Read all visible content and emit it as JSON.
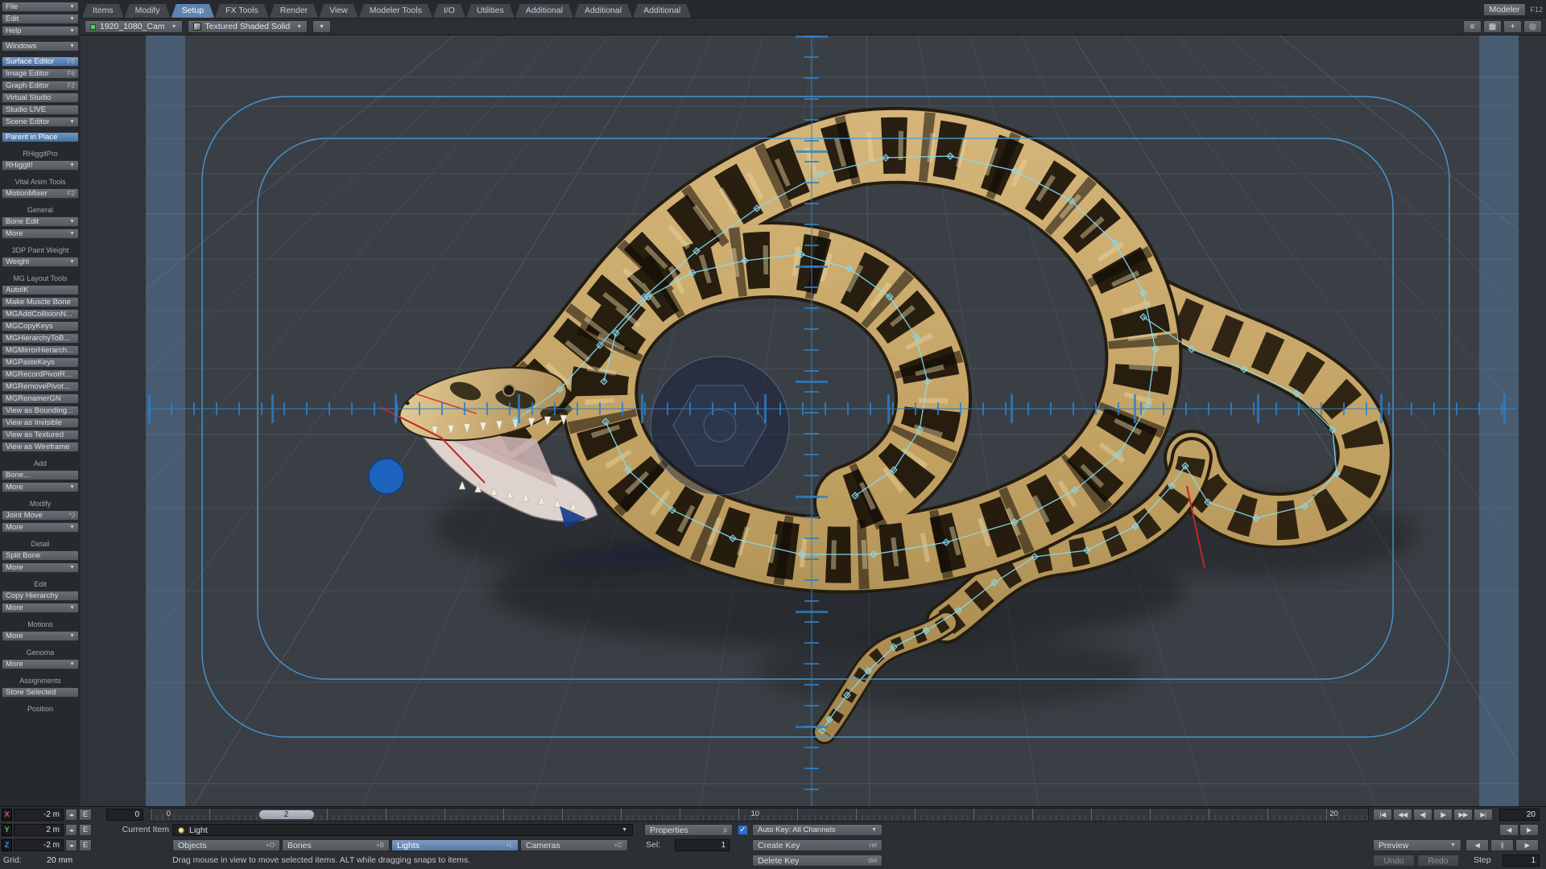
{
  "menus": [
    "File",
    "Edit",
    "Help"
  ],
  "icons": {
    "dropdown": "▼",
    "stepper": "◂▸",
    "check": "✓"
  },
  "tabs": [
    {
      "label": "Items"
    },
    {
      "label": "Modify"
    },
    {
      "label": "Setup",
      "active": true
    },
    {
      "label": "FX Tools"
    },
    {
      "label": "Render"
    },
    {
      "label": "View"
    },
    {
      "label": "Modeler Tools"
    },
    {
      "label": "I/O"
    },
    {
      "label": "Utilities"
    },
    {
      "label": "Additional"
    },
    {
      "label": "Additional"
    },
    {
      "label": "Additional"
    }
  ],
  "top_right": {
    "modeler": "Modeler",
    "shortcut": "F12"
  },
  "viewport_bar": {
    "camera": "1920_1080_Cam",
    "shading": "Textured Shaded Solid",
    "icons": [
      {
        "name": "layout-list-icon",
        "glyph": "≡"
      },
      {
        "name": "pane-layout-icon",
        "glyph": "▦"
      },
      {
        "name": "pan-view-icon",
        "glyph": "+"
      },
      {
        "name": "zoom-view-icon",
        "glyph": "◎"
      }
    ]
  },
  "sidebar": {
    "sections": [
      {
        "label": null,
        "items": [
          {
            "t": "Windows",
            "dd": true
          }
        ]
      },
      {
        "label": null,
        "items": [
          {
            "t": "Surface Editor",
            "sc": "F5",
            "hl": true
          },
          {
            "t": "Image Editor",
            "sc": "F6"
          },
          {
            "t": "Graph Editor",
            "sc": "F2"
          },
          {
            "t": "Virtual Studio"
          },
          {
            "t": "Studio LIVE"
          },
          {
            "t": "Scene Editor",
            "dd": true
          }
        ]
      },
      {
        "label": null,
        "items": [
          {
            "t": "Parent in Place",
            "hl": true
          }
        ]
      },
      {
        "label": "RHiggitPro",
        "items": [
          {
            "t": "RHiggit!",
            "dd": true
          }
        ]
      },
      {
        "label": "Vital Anim Tools",
        "items": [
          {
            "t": "MotionMixer",
            "sc": "F2"
          }
        ]
      },
      {
        "label": "General",
        "items": [
          {
            "t": "Bone Edit",
            "dd": true
          },
          {
            "t": "More",
            "dd": true
          }
        ]
      },
      {
        "label": "3DP Paint Weight",
        "items": [
          {
            "t": "Weight",
            "dd": true
          }
        ]
      },
      {
        "label": "MG Layout Tools",
        "items": [
          {
            "t": "AutoIK"
          },
          {
            "t": "Make Muscle Bone"
          },
          {
            "t": "MGAddCollisionN..."
          },
          {
            "t": "MGCopyKeys"
          },
          {
            "t": "MGHierarchyToB..."
          },
          {
            "t": "MGMirrorHierarch..."
          },
          {
            "t": "MGPasteKeys"
          },
          {
            "t": "MGRecordPivotR..."
          },
          {
            "t": "MGRemovePivot..."
          },
          {
            "t": "MGRenamerGN"
          },
          {
            "t": "View as Bounding..."
          },
          {
            "t": "View as Invisible"
          },
          {
            "t": "View as Textured"
          },
          {
            "t": "View as Wireframe"
          }
        ]
      },
      {
        "label": "Add",
        "items": [
          {
            "t": "Bone..."
          },
          {
            "t": "More",
            "dd": true
          }
        ]
      },
      {
        "label": "Modify",
        "items": [
          {
            "t": "Joint Move",
            "sc": "^J"
          },
          {
            "t": "More",
            "dd": true
          }
        ]
      },
      {
        "label": "Detail",
        "items": [
          {
            "t": "Split Bone"
          },
          {
            "t": "More",
            "dd": true
          }
        ]
      },
      {
        "label": "Edit",
        "items": [
          {
            "t": "Copy Hierarchy"
          },
          {
            "t": "More",
            "dd": true
          }
        ]
      },
      {
        "label": "Motions",
        "items": [
          {
            "t": "More",
            "dd": true
          }
        ]
      },
      {
        "label": "Genoma",
        "items": [
          {
            "t": "More",
            "dd": true
          }
        ]
      },
      {
        "label": "Assignments",
        "items": [
          {
            "t": "Store Selected"
          }
        ]
      },
      {
        "label": "Position",
        "items": []
      }
    ]
  },
  "timeline": {
    "first": "0",
    "last": "20",
    "current": "2",
    "ruler_labels": [
      "0",
      "10",
      "20"
    ],
    "transport": [
      "|◀",
      "◀◀",
      "◀|",
      "|▶",
      "▶▶",
      "▶|"
    ]
  },
  "bottom": {
    "axes": [
      {
        "axis": "X",
        "value": "-2 m"
      },
      {
        "axis": "Y",
        "value": "2 m"
      },
      {
        "axis": "Z",
        "value": "-2 m"
      }
    ],
    "env_label": "E",
    "current_item_label": "Current Item",
    "current_item": "Light",
    "properties": {
      "label": "Properties",
      "sc": "p"
    },
    "autokey_label": "Auto Key: All Channels",
    "item_types": [
      {
        "label": "Objects",
        "sc": "+O"
      },
      {
        "label": "Bones",
        "sc": "+B"
      },
      {
        "label": "Lights",
        "sc": "+L",
        "active": true
      },
      {
        "label": "Cameras",
        "sc": "+C"
      }
    ],
    "sel": {
      "label": "Sel:",
      "value": "1"
    },
    "create_key": {
      "label": "Create Key",
      "sc": "ret"
    },
    "delete_key": {
      "label": "Delete Key",
      "sc": "del"
    },
    "grid": {
      "label": "Grid:",
      "value": "20 mm"
    },
    "status": "Drag mouse in view to move selected items. ALT while dragging snaps to items.",
    "preview_label": "Preview",
    "play_controls": [
      "◀",
      "||",
      "▶"
    ],
    "step_buttons": [
      "◀",
      "▶"
    ],
    "undo": "Undo",
    "redo": "Redo",
    "step": {
      "label": "Step",
      "value": "1"
    }
  },
  "colors": {
    "accent_blue": "#5d83ae",
    "bone_cyan": "#86dcef",
    "selection_blue": "#1b66c9",
    "safe_frame_blue": "#4aa0dd",
    "snake_tan": "#c8a766"
  }
}
